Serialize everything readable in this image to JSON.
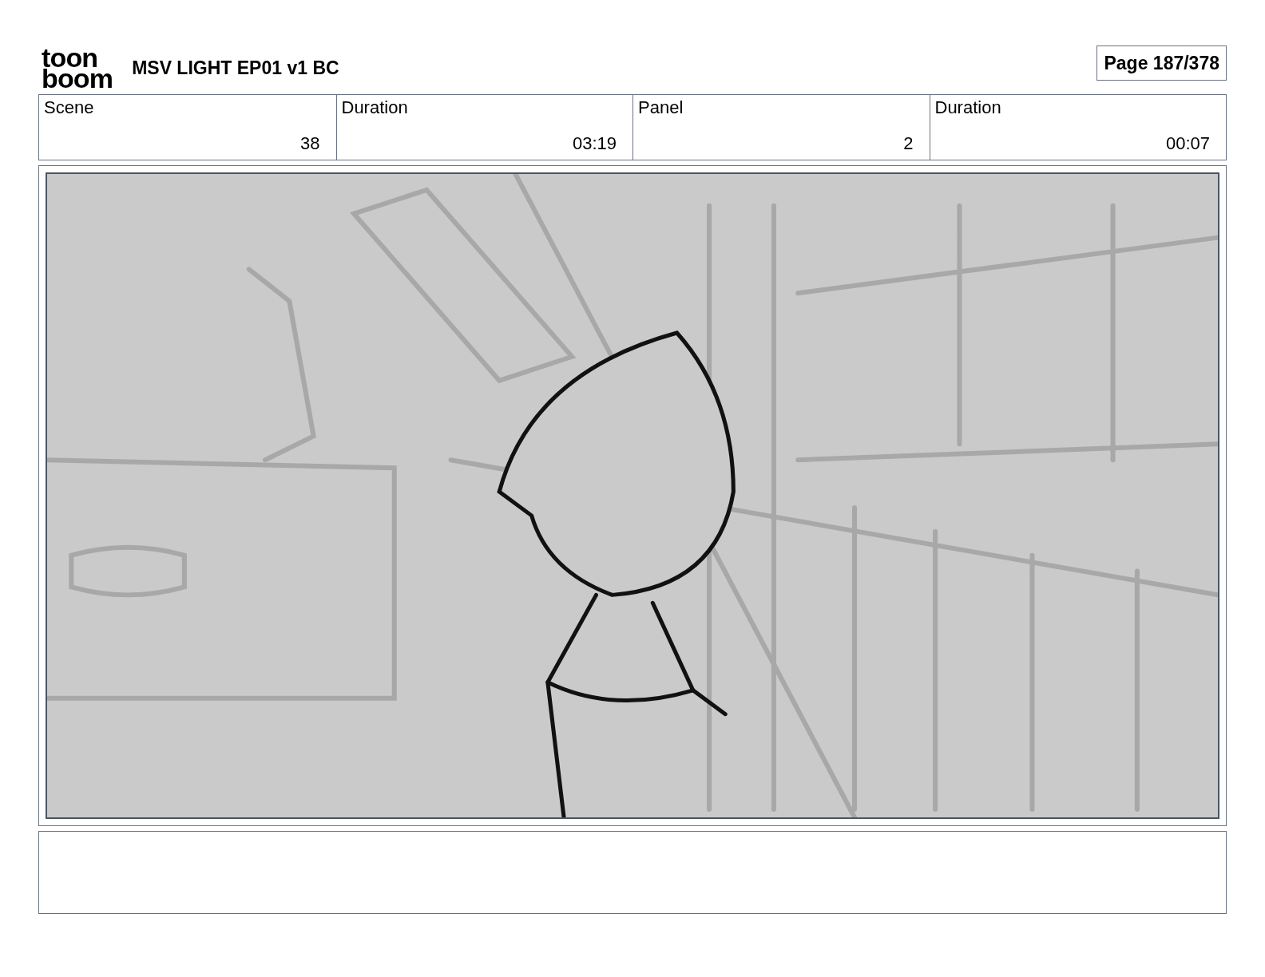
{
  "logo": {
    "lines": [
      "toon",
      "boom"
    ]
  },
  "title": "MSV LIGHT EP01 v1 BC",
  "page": "Page 187/378",
  "fields": [
    {
      "label": "Scene",
      "value": "38"
    },
    {
      "label": "Duration",
      "value": "03:19"
    },
    {
      "label": "Panel",
      "value": "2"
    },
    {
      "label": "Duration",
      "value": "00:07"
    }
  ]
}
